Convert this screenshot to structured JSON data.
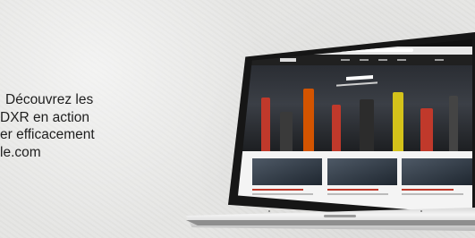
{
  "promo": {
    "lines": [
      "Découvrez les",
      "DXR en action",
      "er efficacement",
      "le.com"
    ]
  },
  "colors": {
    "accent": "#c0392b",
    "screen_frame": "#161616"
  },
  "icons": {
    "laptop": "laptop-icon"
  }
}
